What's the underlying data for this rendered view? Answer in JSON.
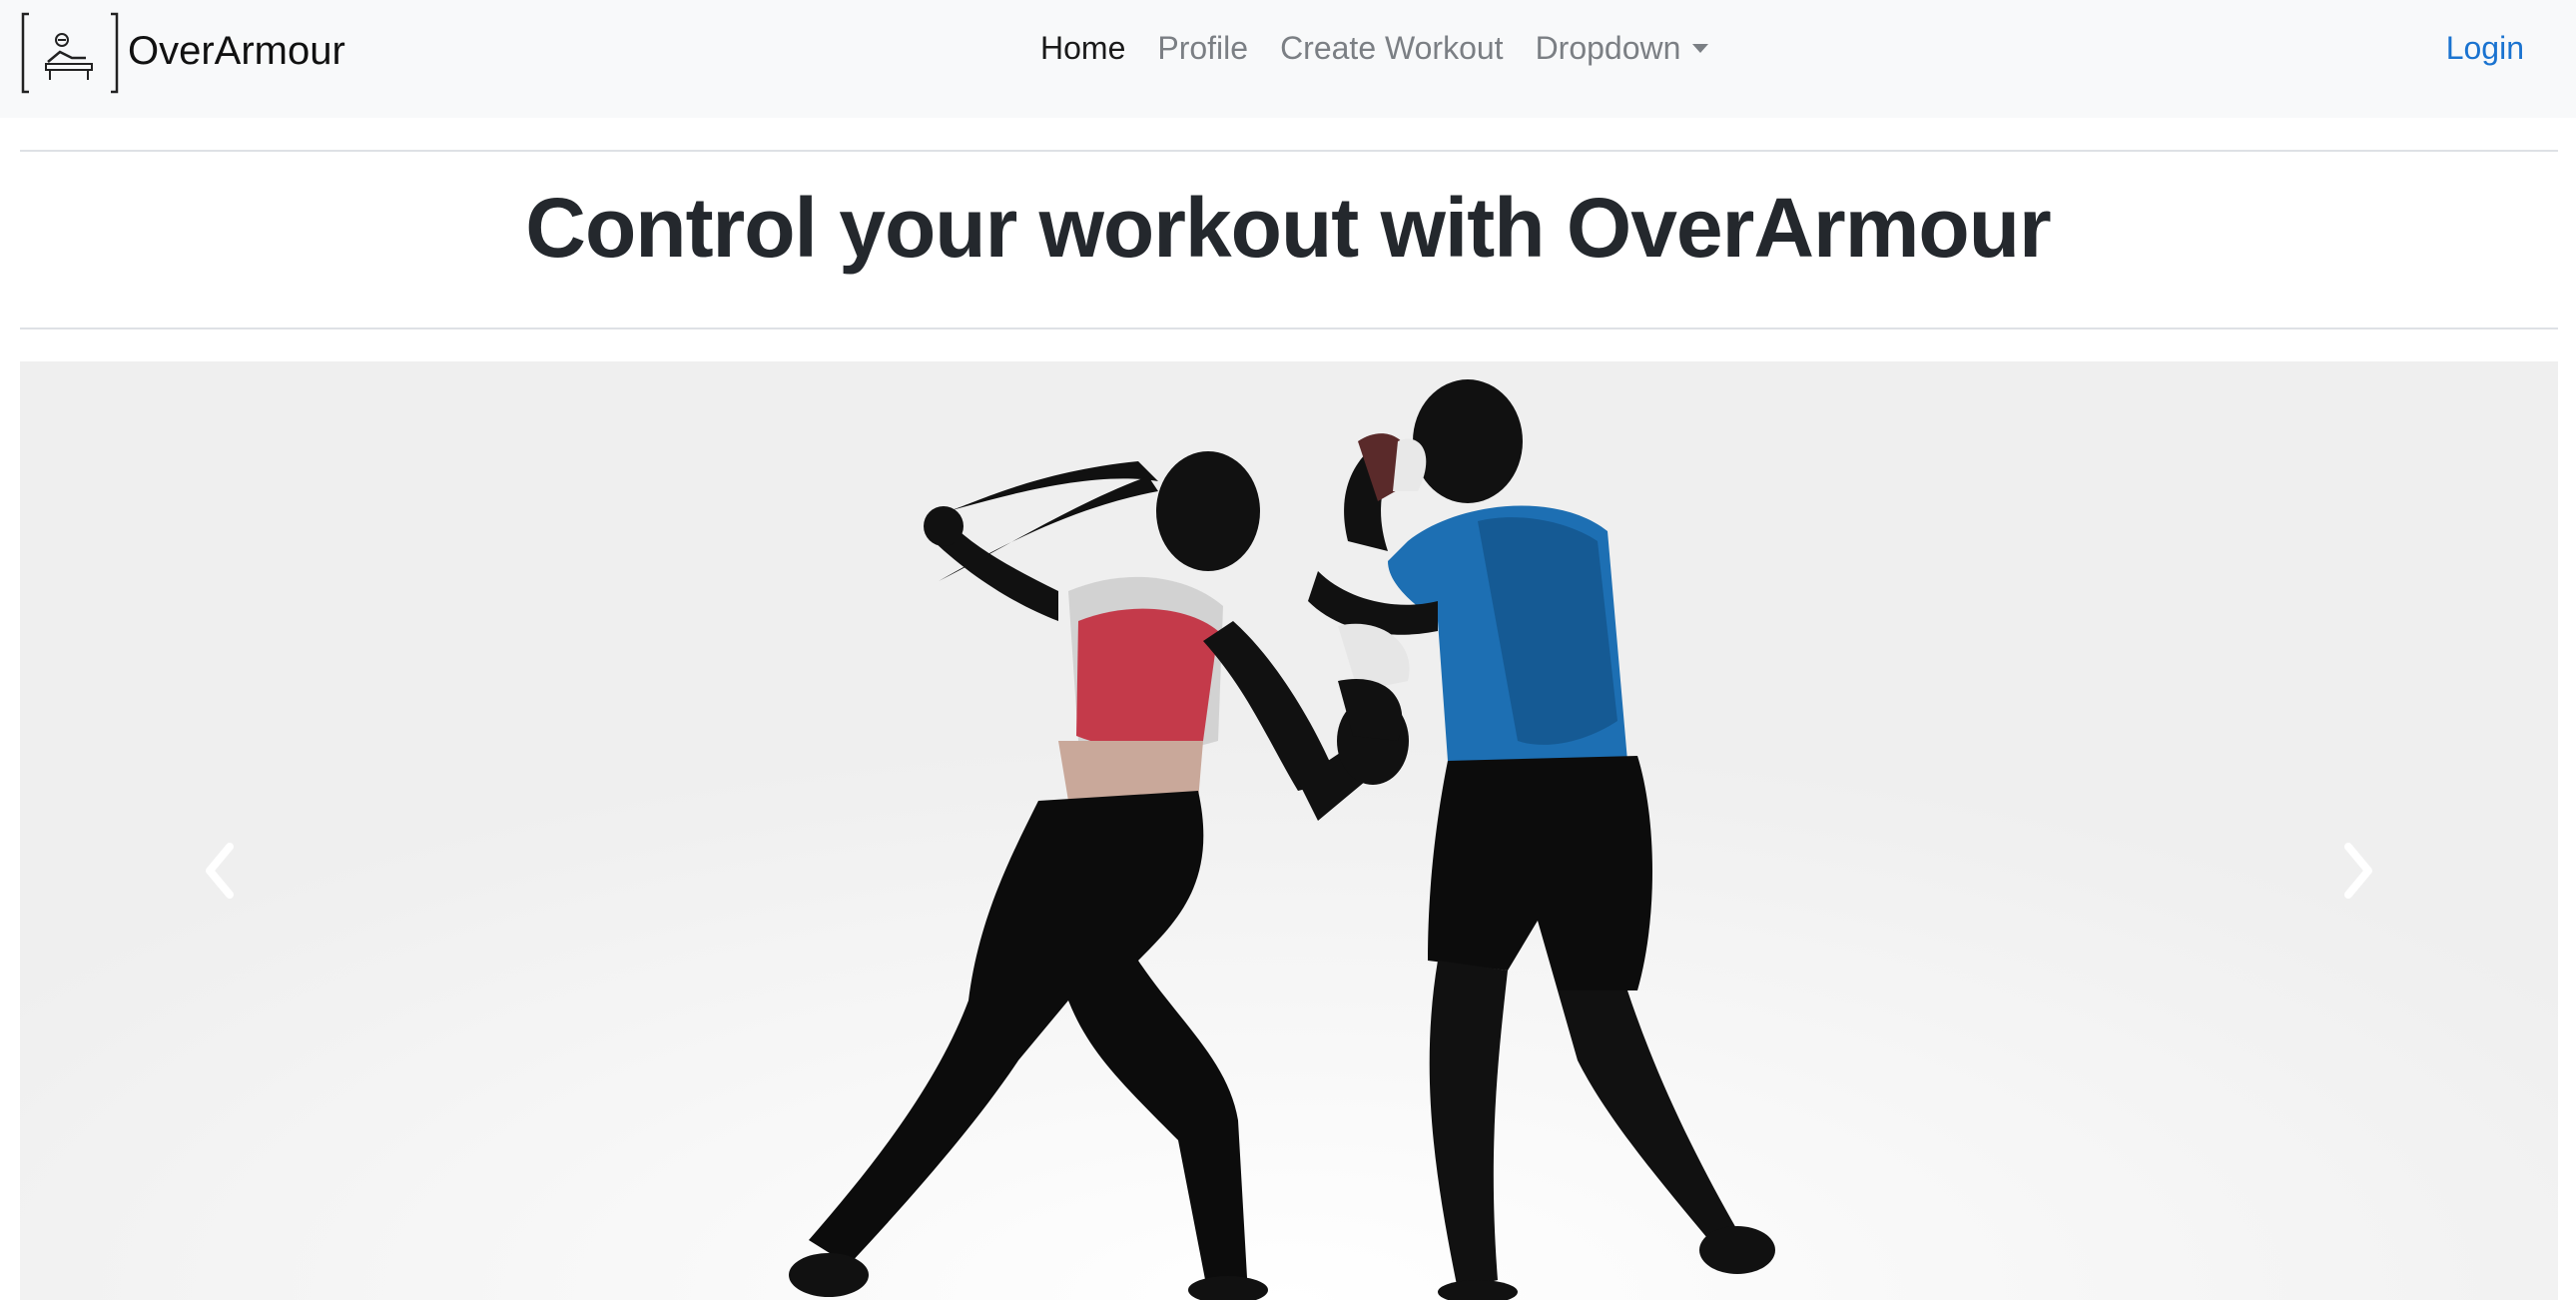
{
  "navbar": {
    "brand": "OverArmour",
    "logo_icon": "bench-press-icon",
    "links": [
      {
        "label": "Home",
        "active": true
      },
      {
        "label": "Profile"
      },
      {
        "label": "Create Workout"
      },
      {
        "label": "Dropdown"
      }
    ],
    "login": "Login"
  },
  "hero": {
    "title": "Control your workout with OverArmour"
  },
  "carousel": {
    "prev_icon": "chevron-left-icon",
    "next_icon": "chevron-right-icon"
  },
  "colors": {
    "navbar_bg": "#f8f9fa",
    "link_accent": "#1a73d0",
    "carousel_bg": "#efefef"
  }
}
